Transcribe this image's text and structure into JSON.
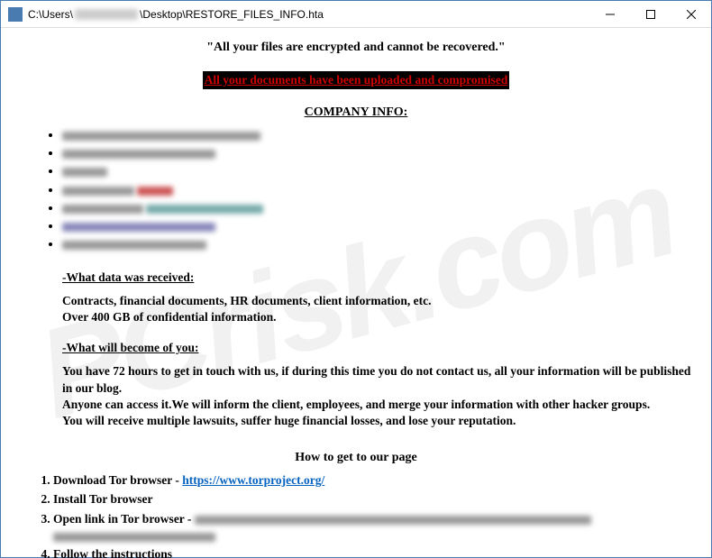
{
  "window": {
    "path_prefix": "C:\\Users\\",
    "path_suffix": "\\Desktop\\RESTORE_FILES_INFO.hta"
  },
  "watermark": "PCrisk.com",
  "headings": {
    "quote": "\"All your files are encrypted and cannot be recovered.\"",
    "red_banner": "All your documents have been uploaded and compromised",
    "company": "COMPANY INFO:",
    "how_to": "How to get to our page"
  },
  "sections": {
    "what_received_title": "-What data was received:",
    "what_received_l1": "Contracts, financial documents, HR documents, client information, etc.",
    "what_received_l2": "Over 400 GB of confidential information.",
    "what_become_title": "-What will become of you:",
    "what_become_l1": "You have 72 hours to get in touch with us, if during this time you do not contact us, all your information will be published in our blog.",
    "what_become_l2": "Anyone can access it.We will inform the client, employees, and merge your information with other hacker groups.",
    "what_become_l3": "You will receive multiple lawsuits, suffer huge financial losses, and lose your reputation."
  },
  "steps": {
    "s1_prefix": "Download Tor browser - ",
    "s1_link": "https://www.torproject.org/",
    "s2": "Install Tor browser",
    "s3_prefix": "Open link in Tor browser - ",
    "s4": "Follow the instructions"
  }
}
